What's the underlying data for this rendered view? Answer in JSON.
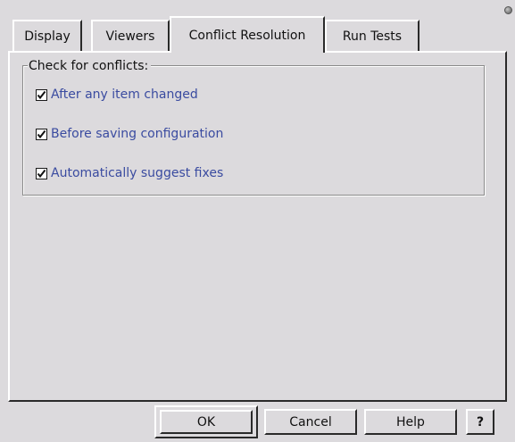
{
  "tabs": [
    {
      "label": "Display",
      "active": false
    },
    {
      "label": "Viewers",
      "active": false
    },
    {
      "label": "Conflict Resolution",
      "active": true
    },
    {
      "label": "Run Tests",
      "active": false
    }
  ],
  "group": {
    "title": "Check for conflicts:",
    "options": [
      {
        "label": "After any item changed",
        "checked": true
      },
      {
        "label": "Before saving configuration",
        "checked": true
      },
      {
        "label": "Automatically suggest fixes",
        "checked": true
      }
    ]
  },
  "buttons": {
    "ok": "OK",
    "cancel": "Cancel",
    "help": "Help",
    "question": "?"
  },
  "colors": {
    "background": "#dcdadd",
    "option_text": "#3a4ba0"
  }
}
